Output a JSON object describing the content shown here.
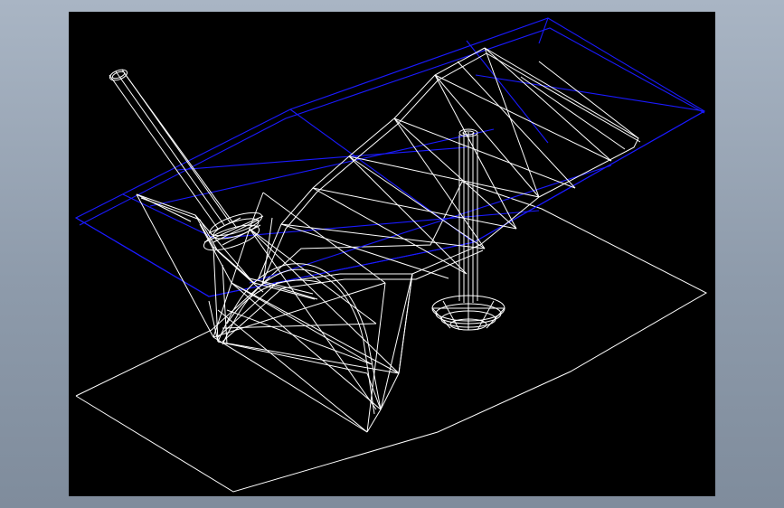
{
  "colors": {
    "frame_background": "#95a2b2",
    "viewport_background": "#000000",
    "structure_lines": "#ffffff",
    "roof_outline_lines": "#1a1aff"
  },
  "diagram": {
    "type": "cad-wireframe",
    "view": "isometric",
    "components": [
      "ground-outline",
      "blue-roof-envelope",
      "white-membrane-canopy",
      "tall-mast-left",
      "tall-mast-right",
      "mast-base-disc-left",
      "mast-base-disc-right",
      "canopy-end-support"
    ]
  }
}
